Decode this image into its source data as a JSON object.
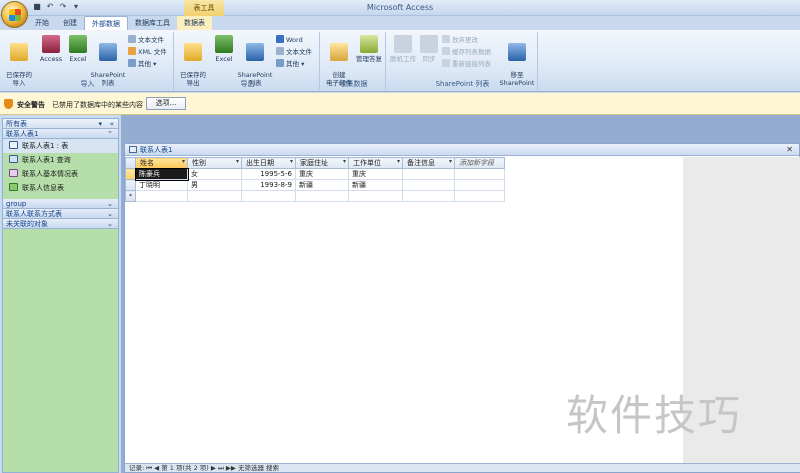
{
  "app": {
    "title": "Microsoft Access",
    "context_tab_group": "表工具"
  },
  "tabs": [
    {
      "label": "开始",
      "active": false
    },
    {
      "label": "创建",
      "active": false
    },
    {
      "label": "外部数据",
      "active": true
    },
    {
      "label": "数据库工具",
      "active": false
    },
    {
      "label": "数据表",
      "active": false,
      "context": true
    }
  ],
  "ribbon": {
    "import_group": {
      "label": "导入",
      "saved_imports": "已保存的\n导入",
      "access": "Access",
      "excel": "Excel",
      "sharepoint_list": "SharePoint\n列表",
      "text_file": "文本文件",
      "xml_file": "XML 文件",
      "more": "其他"
    },
    "export_group": {
      "label": "导出",
      "saved_exports": "已保存的\n导出",
      "excel": "Excel",
      "sharepoint_list": "SharePoint\n列表",
      "word": "Word",
      "text_file": "文本文件",
      "more": "其他"
    },
    "collect_group": {
      "label": "收集数据",
      "create_email": "创建\n电子邮件",
      "manage_replies": "管理答复"
    },
    "sharepoint_group": {
      "label": "SharePoint 列表",
      "work_offline": "脱机工作",
      "sync": "同步",
      "discard_changes": "放弃更改",
      "cache_list_data": "缓存列表数据",
      "relink_lists": "重新链接列表",
      "move_to_sharepoint": "移至\nSharePoint"
    }
  },
  "security_bar": {
    "title": "安全警告",
    "message": "已禁用了数据库中的某些内容",
    "options_button": "选项..."
  },
  "nav_pane": {
    "header": "所有表",
    "groups": [
      {
        "label": "联系人表1",
        "items": [
          {
            "label": "联系人表1 : 表",
            "selected": true
          },
          {
            "label": "联系人表1 查询",
            "selected": false
          },
          {
            "label": "联系人基本情况表",
            "selected": false
          },
          {
            "label": "联系人信息表",
            "selected": false
          }
        ]
      },
      {
        "label": "group"
      },
      {
        "label": "联系人联系方式表"
      },
      {
        "label": "未关联的对象"
      }
    ]
  },
  "document": {
    "tab_title": "联系人表1",
    "columns": [
      "姓名",
      "性别",
      "出生日期",
      "家庭住址",
      "工作单位",
      "备注信息",
      "添加新字段"
    ],
    "rows": [
      [
        "陈豪兵",
        "女",
        "1995-5-6",
        "重庆",
        "重庆",
        "",
        ""
      ],
      [
        "丁晓明",
        "男",
        "1993-8-9",
        "新疆",
        "新疆",
        "",
        ""
      ]
    ],
    "new_row_marker": "*",
    "record_nav": "记录: ⏮ ◀ 第 1 项(共 2 项) ▶ ⏭ ▶▶ 无筛选器  搜索"
  },
  "watermark": "软件技巧"
}
